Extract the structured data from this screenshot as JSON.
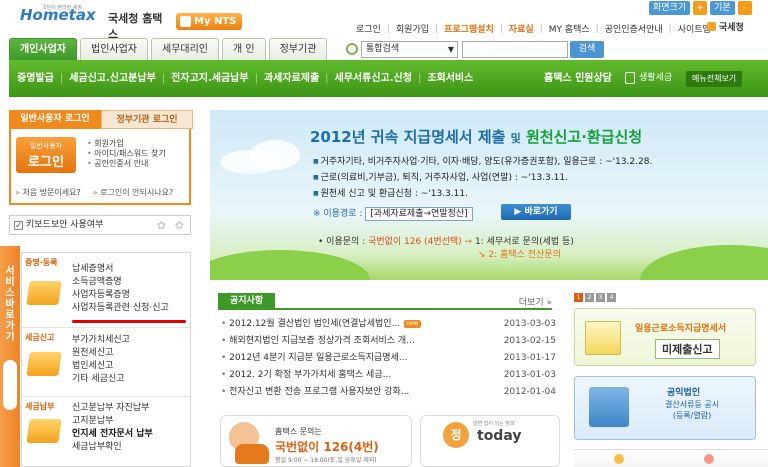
{
  "header": {
    "logo_text": "Hometax",
    "logo_tiny": "국민이 편리한 세정",
    "logo_kor": "국세청 홈택스",
    "mynts_label": "My NTS",
    "zoom_label": "화면크기",
    "zoom_plus": "+",
    "default_label": "기본",
    "zoom_minus": "-",
    "links": [
      "로그인",
      "회원가입",
      "프로그램설치",
      "자료실",
      "MY 홈택스",
      "공인인증서안내",
      "사이트맵"
    ],
    "brand": "국세청"
  },
  "tabs": [
    "개인사업자",
    "법인사업자",
    "세무대리인",
    "개 인",
    "정부기관"
  ],
  "search": {
    "select_value": "통합검색",
    "select_arrow": "▼",
    "button": "검색",
    "placeholder": ""
  },
  "gnav": {
    "items": [
      "증명발급",
      "세금신고.신고분납부",
      "전자고지.세금납부",
      "과세자료제출",
      "세무서류신고.신청",
      "조회서비스"
    ],
    "center": "홈택스 민원상담",
    "life": "생활세금",
    "all_menu": "메뉴전체보기"
  },
  "login": {
    "tab_user": "일반사용자 로그인",
    "tab_gov": "정부기관 로그인",
    "btn_small": "일반사용자",
    "btn_big": "로그인",
    "links": [
      "회원가입",
      "아이디/패스워드 찾기",
      "공인인증서 안내"
    ],
    "foot1": "처음 방문이세요?",
    "foot2": "로그인이 안되시나요?"
  },
  "keyboard": {
    "label": "키보드보안 사용여부"
  },
  "sidebar": {
    "vertical": "서비스바로가기"
  },
  "services": [
    {
      "head": "증명·등록",
      "items": [
        "납세증명서",
        "소득금액증명",
        "사업자등록증명",
        "사업자등록관련 신청·신고"
      ]
    },
    {
      "head": "세금신고",
      "items": [
        "부가가치세신고",
        "원천세신고",
        "법인세신고",
        "기타 세금신고"
      ]
    },
    {
      "head": "세금납부",
      "items": [
        "신고분납부    자진납부",
        "고지분납부",
        "인지세 전자문서 납부",
        "세금납부확인"
      ]
    }
  ],
  "banner": {
    "title_a": "2012년 귀속 지급명세서 제출",
    "title_and": "및",
    "title_b": "원천신고·환급신청",
    "lines": [
      "거주자기타, 비거주자사업·기타, 이자·배당, 양도(유가증권포함), 일용근로 : ~'13.2.28.",
      "근로(의료비,기부금), 퇴직, 거주자사업, 사업(연말) : ~'13.3.11.",
      "원천세 신고 및 환급신청 : ~'13.3.11."
    ],
    "route_label": "※ 이용경로 :",
    "route": "[과세자료제출→연말정산]",
    "route_btn": "바로가기",
    "inquiry": "• 이용문의 :",
    "inquiry_red": "국번없이 126 (4번선택)",
    "inquiry_1": "1: 세무서로 문의(세법 등)",
    "inquiry_2": "2: 홈택스 전산문의"
  },
  "notice": {
    "title": "공지사항",
    "more": "더보기 »",
    "new_badge": "new",
    "rows": [
      {
        "title": "2012.12월 결산법인 법인세(연결납세법인...",
        "date": "2013-03-03",
        "new": true
      },
      {
        "title": "해외현지법인 지급보증 정상가격 조회서비스 개...",
        "date": "2013-02-15",
        "new": false
      },
      {
        "title": "2012년 4분기 지급분 일용근로소득지급명세...",
        "date": "2013-01-17",
        "new": false
      },
      {
        "title": "2012. 2기 확정 부가가치세 홈택스 세금...",
        "date": "2013-01-03",
        "new": false
      },
      {
        "title": "전자신고 변환 전송 프로그램 사용자보안 강화...",
        "date": "2012-01-04",
        "new": false
      }
    ]
  },
  "call": {
    "l1": "홈택스 문의는",
    "l2": "국번없이 126(4번)",
    "l3": "평일 9:00 ~ 18:00(토,일 공휴일 제외)"
  },
  "today": {
    "circle": "정",
    "text": "today",
    "small": "알면 힘이 되는 정보"
  },
  "right": {
    "pager": [
      "1",
      "2",
      "3",
      "4"
    ],
    "card1_l1": "일용근로소득지급명세서",
    "card1_l2": "미제출신고",
    "card2_l1": "공익법인",
    "card2_l2a": "결산서류등 공시",
    "card2_l2b": "(등록/열람)"
  }
}
